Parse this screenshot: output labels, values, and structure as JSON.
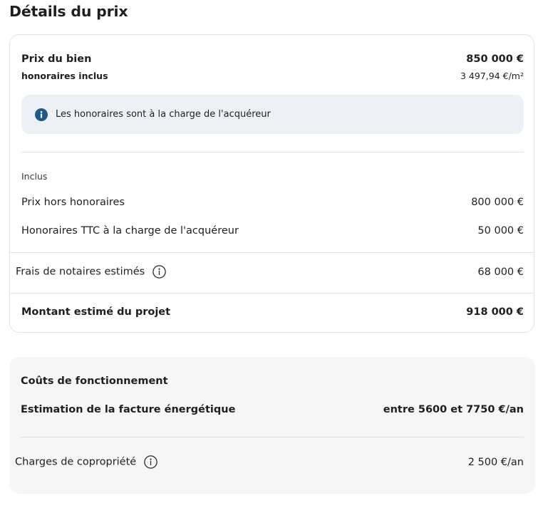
{
  "page": {
    "title": "Détails du prix"
  },
  "price_card": {
    "price_label": "Prix du bien",
    "price_value": "850 000 €",
    "fees_included_label": "honoraires inclus",
    "price_per_m2": "3 497,94 €/m²",
    "info_text": "Les honoraires sont à la charge de l'acquéreur",
    "included_label": "Inclus",
    "price_excl_fees_label": "Prix hors honoraires",
    "price_excl_fees_value": "800 000 €",
    "fees_ttc_label": "Honoraires TTC à la charge de l'acquéreur",
    "fees_ttc_value": "50 000 €",
    "notary_fees_label": "Frais de notaires estimés",
    "notary_fees_value": "68 000 €",
    "project_total_label": "Montant estimé du projet",
    "project_total_value": "918 000 €"
  },
  "running_costs": {
    "title": "Coûts de fonctionnement",
    "energy_label": "Estimation de la facture énergétique",
    "energy_value": "entre 5600 et 7750 €/an",
    "coproperty_label": "Charges de copropriété",
    "coproperty_value": "2 500 €/an"
  },
  "icons": {
    "info_filled": "info-circle-filled-icon",
    "info_outline": "info-circle-outline-icon"
  },
  "colors": {
    "info_icon_bg": "#1f5a86",
    "info_box_bg": "#edf0f5",
    "section_bg": "#f6f6f6",
    "border": "#e3e3e3",
    "text": "#1f1f1f"
  }
}
